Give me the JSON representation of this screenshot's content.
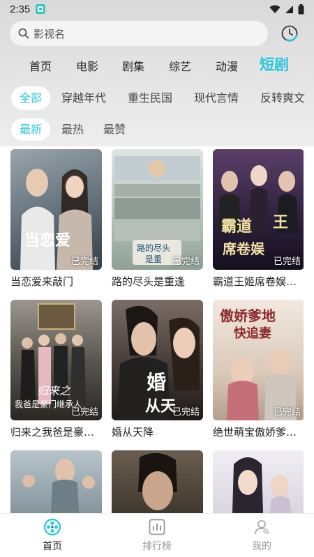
{
  "status_bar": {
    "time": "2:35"
  },
  "search": {
    "placeholder": "影视名"
  },
  "main_tabs": [
    {
      "label": "首页"
    },
    {
      "label": "电影"
    },
    {
      "label": "剧集"
    },
    {
      "label": "综艺"
    },
    {
      "label": "动漫"
    },
    {
      "label": "短剧",
      "active": true
    }
  ],
  "genre_chips": [
    {
      "label": "全部",
      "active": true
    },
    {
      "label": "穿越年代"
    },
    {
      "label": "重生民国"
    },
    {
      "label": "现代言情"
    },
    {
      "label": "反转爽文"
    }
  ],
  "sort_chips": [
    {
      "label": "最新",
      "active": true
    },
    {
      "label": "最热"
    },
    {
      "label": "最赞"
    }
  ],
  "cards": [
    {
      "title": "当恋爱来敲门",
      "badge": "已完结",
      "colors": [
        "#7f8c93",
        "#3d4a56"
      ]
    },
    {
      "title": "路的尽头是重逢",
      "badge": "已完结",
      "colors": [
        "#c9d4d0",
        "#7b8c82"
      ]
    },
    {
      "title": "霸道王姬席卷娱乐圈",
      "badge": "已完结",
      "colors": [
        "#4a3a52",
        "#1e1a2a"
      ]
    },
    {
      "title": "归来之我爸是豪门继承人",
      "badge": "已完结",
      "colors": [
        "#8d8b86",
        "#3a3632"
      ]
    },
    {
      "title": "婚从天降",
      "badge": "已完结",
      "colors": [
        "#6a5f5a",
        "#2a2422"
      ]
    },
    {
      "title": "绝世萌宝傲娇爹地快追妻",
      "badge": "已完结",
      "colors": [
        "#e8dcd4",
        "#b7a396"
      ]
    },
    {
      "title": "",
      "badge": "",
      "colors": [
        "#8a9aa6",
        "#5b6a6e"
      ]
    },
    {
      "title": "",
      "badge": "",
      "colors": [
        "#5a5046",
        "#2a2420"
      ]
    },
    {
      "title": "",
      "badge": "",
      "colors": [
        "#e6e4ea",
        "#b5b0c0"
      ]
    }
  ],
  "bottom_nav": [
    {
      "label": "首页",
      "icon": "film-reel-icon",
      "active": true
    },
    {
      "label": "排行榜",
      "icon": "bar-chart-icon"
    },
    {
      "label": "我的",
      "icon": "user-icon"
    }
  ],
  "colors": {
    "accent": "#29c7d9"
  }
}
